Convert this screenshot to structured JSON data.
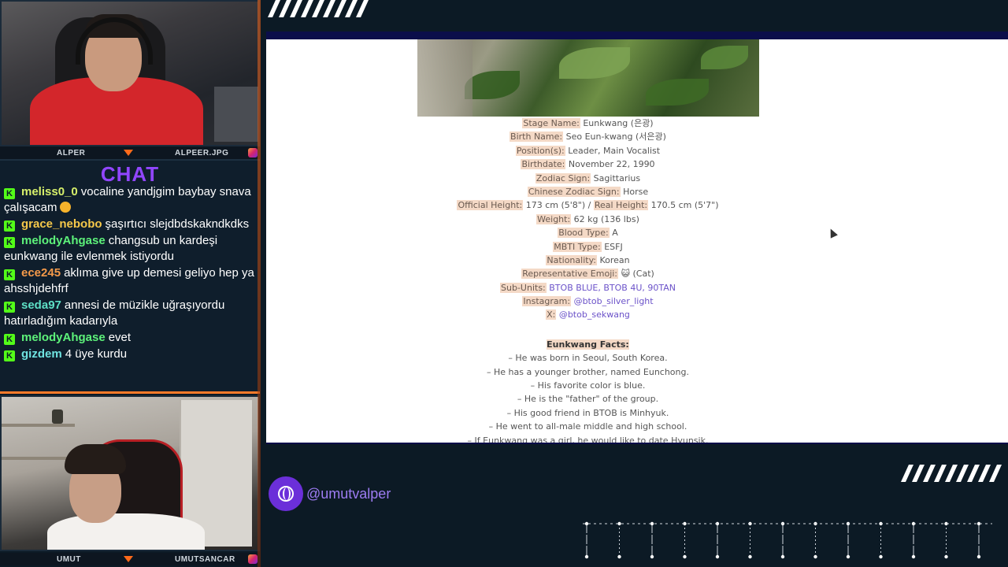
{
  "cams": {
    "top": {
      "left_name": "ALPER",
      "right_name": "ALPEER.JPG"
    },
    "bottom": {
      "left_name": "UMUT",
      "right_name": "UMUTSANCAR"
    }
  },
  "chat": {
    "title": "CHAT",
    "messages": [
      {
        "user": "meliss0_0",
        "color": "#d7f06b",
        "text": "vocaline yandjgim baybay snava çalışacam",
        "emoji": true
      },
      {
        "user": "grace_nebobo",
        "color": "#f5c84a",
        "text": "şaşırtıcı slejdbdskakndkdks",
        "emoji": false
      },
      {
        "user": "melodyAhgase",
        "color": "#5df27a",
        "text": "changsub un kardeşi eunkwang ile evlenmek istiyordu",
        "emoji": false
      },
      {
        "user": "ece245",
        "color": "#f59a4a",
        "text": "aklıma give up demesi geliyo hep ya ahsshjdehfrf",
        "emoji": false
      },
      {
        "user": "seda97",
        "color": "#5ee0c6",
        "text": "annesi de müzikle uğraşıyordu hatırladığım kadarıyla",
        "emoji": false
      },
      {
        "user": "melodyAhgase",
        "color": "#5df27a",
        "text": "evet",
        "emoji": false
      },
      {
        "user": "gizdem",
        "color": "#6fe3e0",
        "text": "4 üye kurdu",
        "emoji": false
      }
    ]
  },
  "profile": {
    "stage_name": {
      "label": "Stage Name:",
      "value": " Eunkwang (은광)"
    },
    "birth_name": {
      "label": "Birth Name:",
      "value": " Seo Eun-kwang (서은광)"
    },
    "positions": {
      "label": "Position(s):",
      "value": " Leader, Main Vocalist"
    },
    "birthdate": {
      "label": "Birthdate:",
      "value": " November 22, 1990"
    },
    "zodiac": {
      "label": "Zodiac Sign:",
      "value": " Sagittarius"
    },
    "chinese_zodiac": {
      "label": "Chinese Zodiac Sign:",
      "value": " Horse"
    },
    "official_height": {
      "label": "Official Height:",
      "value": " 173 cm (5'8\") / "
    },
    "real_height": {
      "label": "Real Height:",
      "value": " 170.5 cm (5'7\")"
    },
    "weight": {
      "label": "Weight:",
      "value": " 62 kg (136 lbs)"
    },
    "blood": {
      "label": "Blood Type:",
      "value": " A"
    },
    "mbti": {
      "label": "MBTI Type:",
      "value": " ESFJ"
    },
    "nationality": {
      "label": "Nationality:",
      "value": " Korean"
    },
    "emoji": {
      "label": "Representative Emoji:",
      "value": " 😺 (Cat)"
    },
    "subunits": {
      "label": "Sub-Units:",
      "value": "BTOB BLUE, BTOB 4U, 90TAN"
    },
    "instagram": {
      "label": "Instagram:",
      "value": "@btob_silver_light"
    },
    "x": {
      "label": "X:",
      "value": "@btob_sekwang"
    },
    "facts_title": "Eunkwang Facts:",
    "facts": [
      "– He was born in Seoul, South Korea.",
      "– He has a younger brother, named Eunchong.",
      "– His favorite color is blue.",
      "– He is the \"father\" of the group.",
      "– His good friend in BTOB is Minhyuk.",
      "– He went to all-male middle and high school.",
      "– If Eunkwang was a girl, he would like to date Hyunsik."
    ]
  },
  "footer": {
    "handle": "@umutvalper"
  }
}
